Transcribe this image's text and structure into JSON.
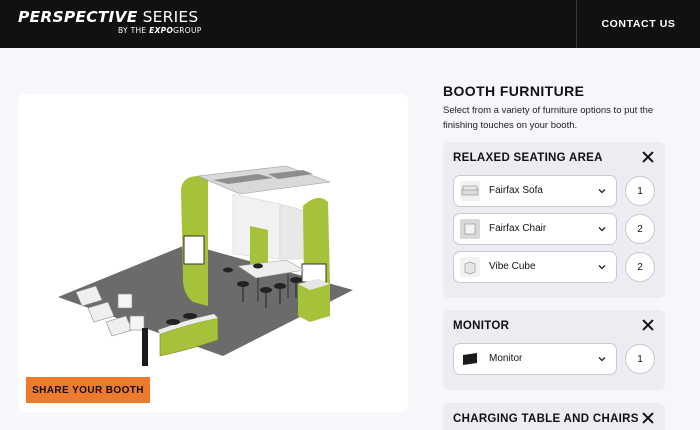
{
  "header": {
    "brand_main_bold": "PERSPECTIVE",
    "brand_main_light": "SERIES",
    "brand_sub_prefix": "BY THE ",
    "brand_sub_bold": "EXPO",
    "brand_sub_suffix": "GROUP",
    "contact_label": "CONTACT US"
  },
  "preview": {
    "share_label": "SHARE YOUR BOOTH",
    "accent_color": "#a6c23a",
    "floor_color": "#6b6b6b"
  },
  "panel": {
    "title": "BOOTH FURNITURE",
    "description": "Select from a variety of furniture options to put the finishing touches on your booth.",
    "sections": [
      {
        "title": "RELAXED SEATING AREA",
        "items": [
          {
            "label": "Fairfax Sofa",
            "qty": "1",
            "icon": "sofa-thumbnail"
          },
          {
            "label": "Fairfax Chair",
            "qty": "2",
            "icon": "chair-thumbnail"
          },
          {
            "label": "Vibe Cube",
            "qty": "2",
            "icon": "cube-thumbnail"
          }
        ]
      },
      {
        "title": "MONITOR",
        "items": [
          {
            "label": "Monitor",
            "qty": "1",
            "icon": "monitor-thumbnail"
          }
        ]
      },
      {
        "title": "CHARGING TABLE AND CHAIRS",
        "items": []
      }
    ]
  }
}
